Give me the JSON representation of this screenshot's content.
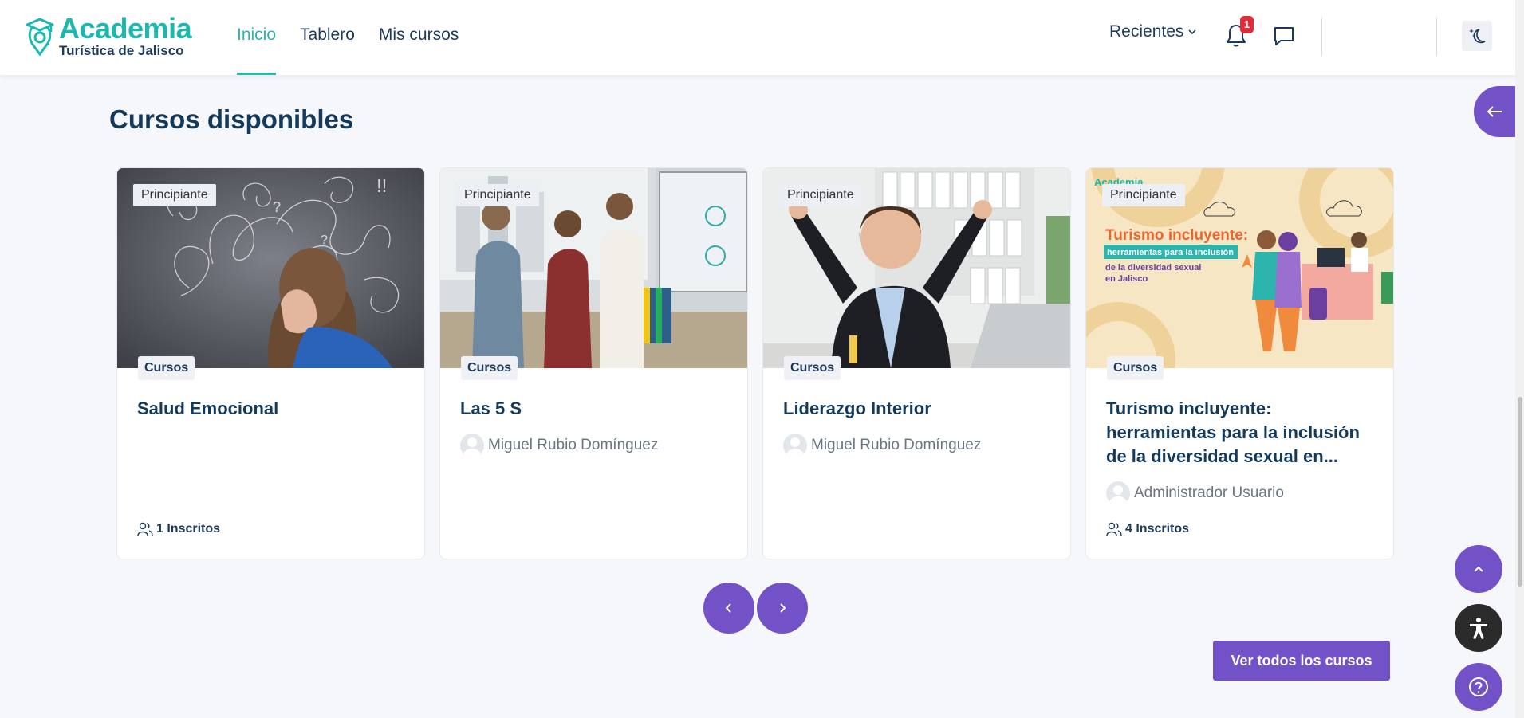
{
  "header": {
    "logo_line1": "Academia",
    "logo_line2": "Turística de Jalisco",
    "nav": [
      {
        "label": "Inicio",
        "active": true
      },
      {
        "label": "Tablero",
        "active": false
      },
      {
        "label": "Mis cursos",
        "active": false
      }
    ],
    "recientes_label": "Recientes",
    "notification_count": "1",
    "icons": {
      "notifications": "bell-icon",
      "messages": "chat-icon",
      "theme": "moon-stars-icon",
      "dropdown": "chevron-down-icon"
    }
  },
  "drawer_toggle_icon": "arrow-left-icon",
  "section": {
    "title": "Cursos disponibles"
  },
  "courses": [
    {
      "level": "Principiante",
      "category": "Cursos",
      "title": "Salud Emocional",
      "instructor": "",
      "enrolled": "1 Inscritos"
    },
    {
      "level": "Principiante",
      "category": "Cursos",
      "title": "Las 5 S",
      "instructor": "Miguel Rubio Domínguez",
      "enrolled": ""
    },
    {
      "level": "Principiante",
      "category": "Cursos",
      "title": "Liderazgo Interior",
      "instructor": "Miguel Rubio Domínguez",
      "enrolled": ""
    },
    {
      "level": "Principiante",
      "category": "Cursos",
      "title": "Turismo incluyente: herramientas para la inclusión de la diversidad sexual en...",
      "instructor": "Administrador Usuario",
      "enrolled": "4 Inscritos",
      "image_text": {
        "brand": "Academia",
        "headline": "Turismo incluyente:",
        "sub1": "herramientas para la inclusión",
        "sub2": "de la diversidad sexual",
        "sub3": "en Jalisco"
      }
    }
  ],
  "pagination": {
    "prev_icon": "chevron-left-icon",
    "next_icon": "chevron-right-icon"
  },
  "view_all_label": "Ver todos los cursos",
  "floating": {
    "scroll_top_icon": "chevron-up-icon",
    "accessibility_icon": "accessibility-icon",
    "help_icon": "question-icon"
  },
  "colors": {
    "brand_teal": "#1bb8b0",
    "navy": "#133a5b",
    "accent_purple": "#7352c7",
    "badge_red": "#e02b3b"
  }
}
